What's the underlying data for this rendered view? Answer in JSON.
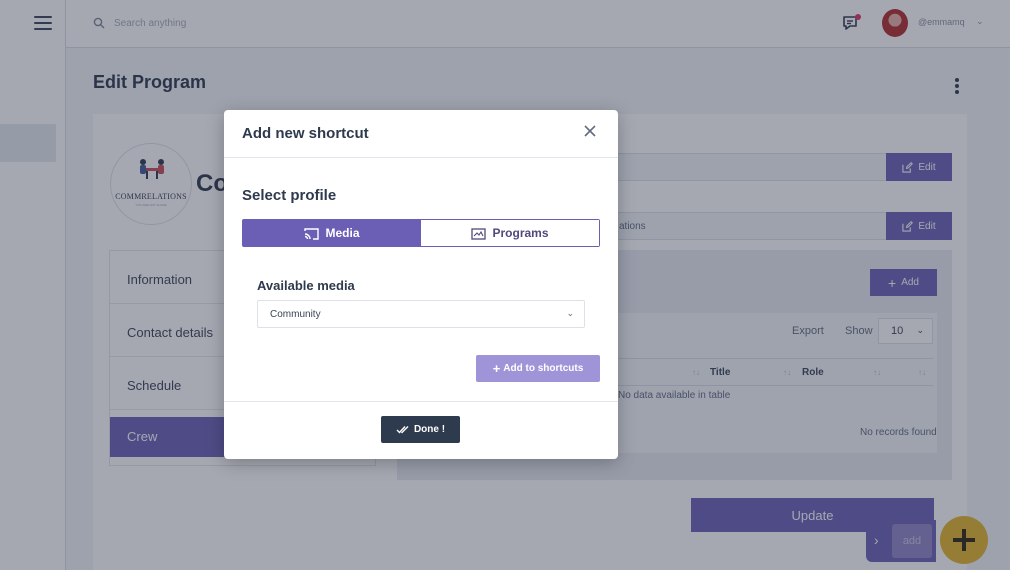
{
  "topbar": {
    "search_placeholder": "Search anything",
    "username": "@emmamq"
  },
  "page": {
    "title": "Edit Program",
    "org_name": "Co",
    "logo_text": "COMMRELATIONS",
    "logo_subtext": "YOU ARE NOT ALONE"
  },
  "fields": {
    "row1_value": "",
    "row2_value": "ations",
    "edit_label": "Edit"
  },
  "side_tabs": [
    "Information",
    "Contact details",
    "Schedule",
    "Crew"
  ],
  "active_tab": "Crew",
  "crew": {
    "add_label": "Add",
    "export_label": "Export",
    "show_label": "Show",
    "show_value": "10",
    "columns": [
      "Title",
      "Role"
    ],
    "empty_message": "No data available in table",
    "no_records": "No records found"
  },
  "actions": {
    "update_label": "Update",
    "tray_add_label": "add"
  },
  "modal": {
    "title": "Add new shortcut",
    "section_title": "Select profile",
    "toggle": [
      {
        "label": "Media",
        "icon": "cast-icon",
        "selected": true
      },
      {
        "label": "Programs",
        "icon": "tv-program-icon",
        "selected": false
      }
    ],
    "field_label": "Available media",
    "select_value": "Community",
    "add_button_label": "Add to shortcuts",
    "done_button_label": "Done !"
  },
  "colors": {
    "accent": "#6b5fb5",
    "accent_light": "#9f94d8",
    "dark_button": "#2e3a4d",
    "fab": "#e3b52a",
    "notification": "#e0336b"
  }
}
